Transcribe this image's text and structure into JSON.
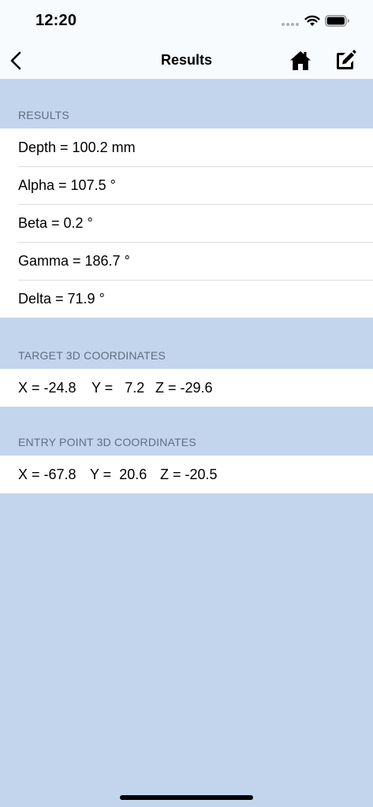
{
  "status_bar": {
    "time": "12:20"
  },
  "nav": {
    "title": "Results",
    "back_icon": "chevron-left-icon",
    "home_icon": "home-icon",
    "edit_icon": "edit-icon"
  },
  "results": {
    "header": "RESULTS",
    "items": [
      {
        "label": "Depth = 100.2 mm"
      },
      {
        "label": "Alpha = 107.5 °"
      },
      {
        "label": "Beta = 0.2 °"
      },
      {
        "label": "Gamma = 186.7 °"
      },
      {
        "label": "Delta = 71.9 °"
      }
    ]
  },
  "target": {
    "header": "TARGET 3D COORDINATES",
    "x": "X = -24.8",
    "y": "Y =   7.2",
    "z": "Z = -29.6"
  },
  "entry": {
    "header": "ENTRY POINT 3D COORDINATES",
    "x": "X = -67.8",
    "y": "Y =  20.6",
    "z": "Z = -20.5"
  },
  "colors": {
    "background": "#c3d5ed",
    "bar": "#f8fbfd",
    "section_header": "#5f6e80"
  }
}
